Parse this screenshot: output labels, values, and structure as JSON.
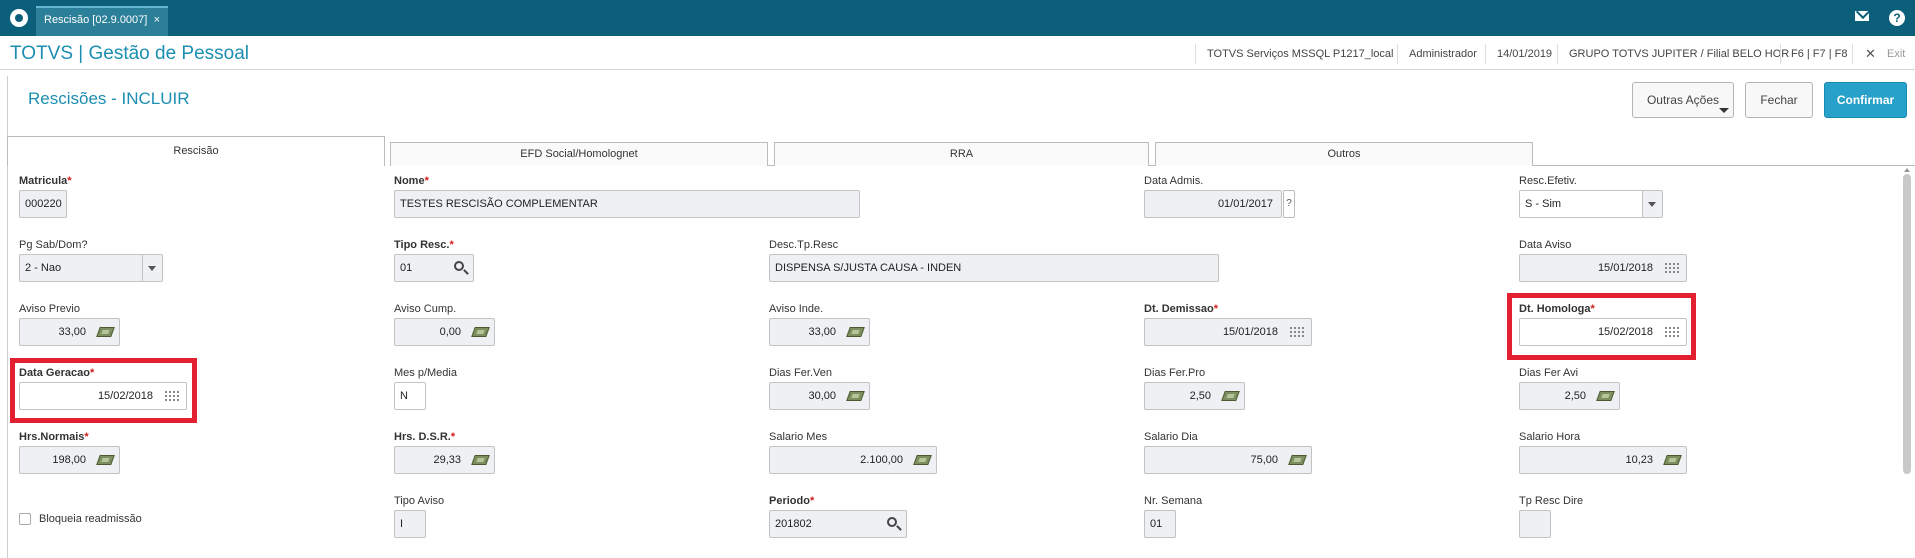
{
  "window": {
    "tab_label": "Rescisão [02.9.0007]",
    "close_glyph": "×"
  },
  "header": {
    "app_title": "TOTVS | Gestão de Pessoal",
    "environment": "TOTVS Serviços MSSQL P1217_local",
    "user": "Administrador",
    "date": "14/01/2019",
    "company": "GRUPO TOTVS JUPITER / Filial BELO HOR",
    "shortcuts": "F6 | F7 | F8",
    "exit_label": "Exit"
  },
  "page": {
    "title": "Rescisões - INCLUIR",
    "actions": {
      "more": "Outras Ações",
      "close": "Fechar",
      "confirm": "Confirmar"
    }
  },
  "tabs": [
    "Rescisão",
    "EFD Social/Homolognet",
    "RRA",
    "Outros"
  ],
  "form": {
    "matricula": {
      "label": "Matricula",
      "value": "000220"
    },
    "nome": {
      "label": "Nome",
      "value": "TESTES RESCISÃO COMPLEMENTAR"
    },
    "data_admis": {
      "label": "Data Admis.",
      "value": "01/01/2017",
      "help": "?"
    },
    "resc_efetiv": {
      "label": "Resc.Efetiv.",
      "value": "S - Sim"
    },
    "pg_sab_dom": {
      "label": "Pg Sab/Dom?",
      "value": "2 - Nao"
    },
    "tipo_resc": {
      "label": "Tipo Resc.",
      "value": "01"
    },
    "desc_tp_resc": {
      "label": "Desc.Tp.Resc",
      "value": "DISPENSA S/JUSTA CAUSA - INDEN"
    },
    "data_aviso": {
      "label": "Data Aviso",
      "value": "15/01/2018"
    },
    "aviso_previo": {
      "label": "Aviso Previo",
      "value": "33,00"
    },
    "aviso_cump": {
      "label": "Aviso Cump.",
      "value": "0,00"
    },
    "aviso_inde": {
      "label": "Aviso Inde.",
      "value": "33,00"
    },
    "dt_demissao": {
      "label": "Dt. Demissao",
      "value": "15/01/2018"
    },
    "dt_homologa": {
      "label": "Dt. Homologa",
      "value": "15/02/2018"
    },
    "data_geracao": {
      "label": "Data Geracao",
      "value": "15/02/2018"
    },
    "mes_media": {
      "label": "Mes p/Media",
      "value": "N"
    },
    "dias_fer_ven": {
      "label": "Dias Fer.Ven",
      "value": "30,00"
    },
    "dias_fer_pro": {
      "label": "Dias Fer.Pro",
      "value": "2,50"
    },
    "dias_fer_avi": {
      "label": "Dias Fer Avi",
      "value": "2,50"
    },
    "hrs_normais": {
      "label": "Hrs.Normais",
      "value": "198,00"
    },
    "hrs_dsr": {
      "label": "Hrs. D.S.R.",
      "value": "29,33"
    },
    "salario_mes": {
      "label": "Salario Mes",
      "value": "2.100,00"
    },
    "salario_dia": {
      "label": "Salario Dia",
      "value": "75,00"
    },
    "salario_hora": {
      "label": "Salario Hora",
      "value": "10,23"
    },
    "bloqueia": {
      "label": "Bloqueia readmissão"
    },
    "tipo_aviso": {
      "label": "Tipo Aviso",
      "value": "I"
    },
    "periodo": {
      "label": "Periodo",
      "value": "201802"
    },
    "nr_semana": {
      "label": "Nr. Semana",
      "value": "01"
    },
    "tp_resc_dire": {
      "label": "Tp Resc Dire",
      "value": ""
    }
  },
  "required_marker": "*",
  "highlight_color": "#e3202f"
}
